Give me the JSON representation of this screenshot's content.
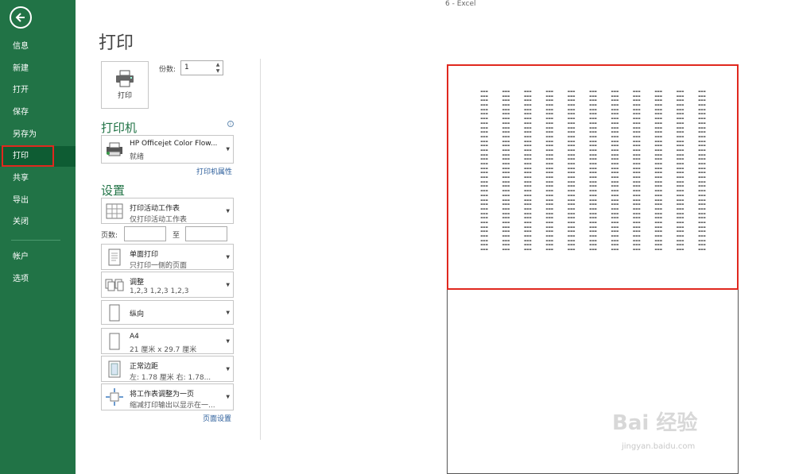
{
  "window": {
    "title": "6 - Excel"
  },
  "nav": {
    "items": [
      {
        "label": "信息"
      },
      {
        "label": "新建"
      },
      {
        "label": "打开"
      },
      {
        "label": "保存"
      },
      {
        "label": "另存为"
      },
      {
        "label": "打印"
      },
      {
        "label": "共享"
      },
      {
        "label": "导出"
      },
      {
        "label": "关闭"
      },
      {
        "label": "帐户"
      },
      {
        "label": "选项"
      }
    ],
    "active": "打印",
    "accent": "#217346"
  },
  "page": {
    "title": "打印"
  },
  "print": {
    "button_label": "打印",
    "copies_label": "份数:",
    "copies_value": "1"
  },
  "printer": {
    "heading": "打印机",
    "name": "HP Officejet Color Flow...",
    "status": "就绪",
    "properties_link": "打印机属性"
  },
  "settings": {
    "heading": "设置",
    "scope": {
      "title": "打印活动工作表",
      "sub": "仅打印活动工作表"
    },
    "pages_label": "页数:",
    "pages_to": "至",
    "sides": {
      "title": "单面打印",
      "sub": "只打印一侧的页面"
    },
    "collate": {
      "title": "调整",
      "sub": "1,2,3    1,2,3    1,2,3"
    },
    "orientation": {
      "title": "纵向"
    },
    "paper": {
      "title": "A4",
      "sub": "21 厘米 x 29.7 厘米"
    },
    "margins": {
      "title": "正常边距",
      "sub": "左: 1.78 厘米    右: 1.78..."
    },
    "scaling": {
      "title": "将工作表调整为一页",
      "sub": "缩减打印输出以显示在一..."
    },
    "page_setup_link": "页面设置"
  },
  "watermark": {
    "brand": "Bai 经验",
    "url": "jingyan.baidu.com"
  },
  "colors": {
    "highlight": "#e0281e",
    "link": "#2a5c9a"
  }
}
